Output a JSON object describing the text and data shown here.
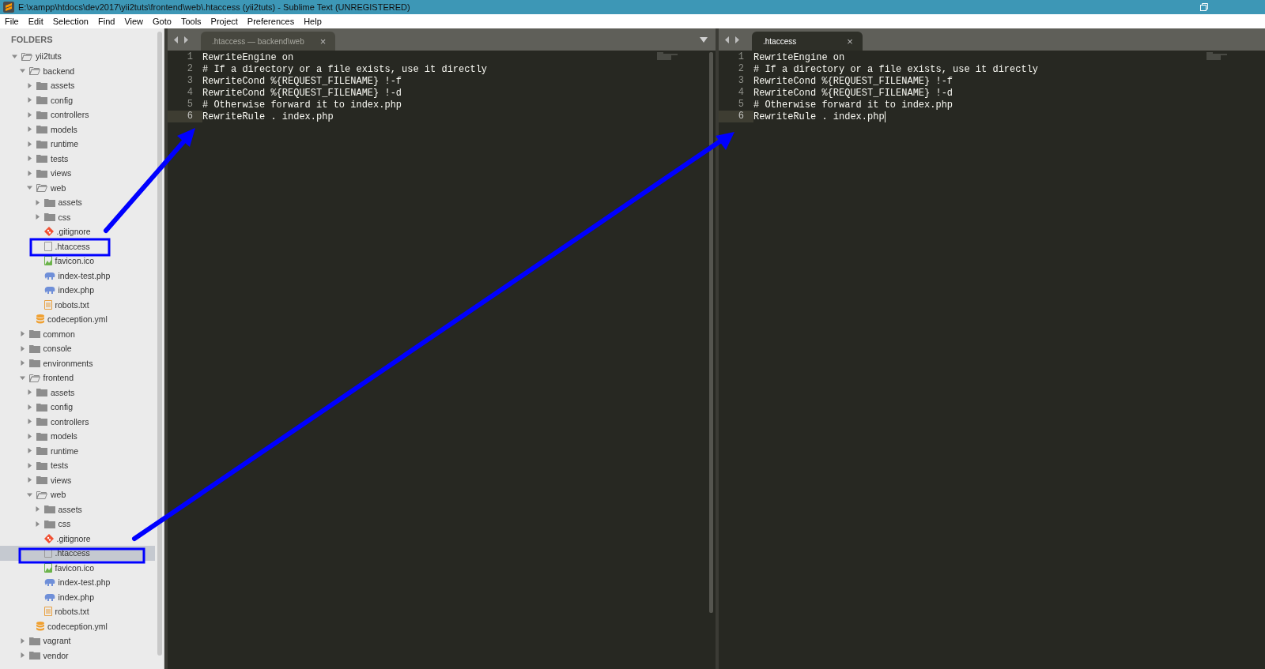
{
  "window": {
    "title": "E:\\xampp\\htdocs\\dev2017\\yii2tuts\\frontend\\web\\.htaccess (yii2tuts) - Sublime Text (UNREGISTERED)"
  },
  "menu": [
    "File",
    "Edit",
    "Selection",
    "Find",
    "View",
    "Goto",
    "Tools",
    "Project",
    "Preferences",
    "Help"
  ],
  "sidebar": {
    "heading": "FOLDERS",
    "tree": [
      {
        "label": "yii2tuts",
        "kind": "folder",
        "expanded": true,
        "selected": false,
        "children": [
          {
            "label": "backend",
            "kind": "folder",
            "expanded": true,
            "selected": false,
            "children": [
              {
                "label": "assets",
                "kind": "folder",
                "expanded": false,
                "selected": false
              },
              {
                "label": "config",
                "kind": "folder",
                "expanded": false,
                "selected": false
              },
              {
                "label": "controllers",
                "kind": "folder",
                "expanded": false,
                "selected": false
              },
              {
                "label": "models",
                "kind": "folder",
                "expanded": false,
                "selected": false
              },
              {
                "label": "runtime",
                "kind": "folder",
                "expanded": false,
                "selected": false
              },
              {
                "label": "tests",
                "kind": "folder",
                "expanded": false,
                "selected": false
              },
              {
                "label": "views",
                "kind": "folder",
                "expanded": false,
                "selected": false
              },
              {
                "label": "web",
                "kind": "folder",
                "expanded": true,
                "selected": false,
                "children": [
                  {
                    "label": "assets",
                    "kind": "folder",
                    "expanded": false,
                    "selected": false
                  },
                  {
                    "label": "css",
                    "kind": "folder",
                    "expanded": false,
                    "selected": false
                  },
                  {
                    "label": ".gitignore",
                    "kind": "git",
                    "selected": false
                  },
                  {
                    "label": ".htaccess",
                    "kind": "file",
                    "selected": false
                  },
                  {
                    "label": "favicon.ico",
                    "kind": "image",
                    "selected": false
                  },
                  {
                    "label": "index-test.php",
                    "kind": "php",
                    "selected": false
                  },
                  {
                    "label": "index.php",
                    "kind": "php",
                    "selected": false
                  },
                  {
                    "label": "robots.txt",
                    "kind": "text",
                    "selected": false
                  }
                ]
              },
              {
                "label": "codeception.yml",
                "kind": "yaml",
                "selected": false
              }
            ]
          },
          {
            "label": "common",
            "kind": "folder",
            "expanded": false,
            "selected": false
          },
          {
            "label": "console",
            "kind": "folder",
            "expanded": false,
            "selected": false
          },
          {
            "label": "environments",
            "kind": "folder",
            "expanded": false,
            "selected": false
          },
          {
            "label": "frontend",
            "kind": "folder",
            "expanded": true,
            "selected": false,
            "children": [
              {
                "label": "assets",
                "kind": "folder",
                "expanded": false,
                "selected": false
              },
              {
                "label": "config",
                "kind": "folder",
                "expanded": false,
                "selected": false
              },
              {
                "label": "controllers",
                "kind": "folder",
                "expanded": false,
                "selected": false
              },
              {
                "label": "models",
                "kind": "folder",
                "expanded": false,
                "selected": false
              },
              {
                "label": "runtime",
                "kind": "folder",
                "expanded": false,
                "selected": false
              },
              {
                "label": "tests",
                "kind": "folder",
                "expanded": false,
                "selected": false
              },
              {
                "label": "views",
                "kind": "folder",
                "expanded": false,
                "selected": false
              },
              {
                "label": "web",
                "kind": "folder",
                "expanded": true,
                "selected": false,
                "children": [
                  {
                    "label": "assets",
                    "kind": "folder",
                    "expanded": false,
                    "selected": false
                  },
                  {
                    "label": "css",
                    "kind": "folder",
                    "expanded": false,
                    "selected": false
                  },
                  {
                    "label": ".gitignore",
                    "kind": "git",
                    "selected": false
                  },
                  {
                    "label": ".htaccess",
                    "kind": "file",
                    "selected": true
                  },
                  {
                    "label": "favicon.ico",
                    "kind": "image",
                    "selected": false
                  },
                  {
                    "label": "index-test.php",
                    "kind": "php",
                    "selected": false
                  },
                  {
                    "label": "index.php",
                    "kind": "php",
                    "selected": false
                  },
                  {
                    "label": "robots.txt",
                    "kind": "text",
                    "selected": false
                  }
                ]
              },
              {
                "label": "codeception.yml",
                "kind": "yaml",
                "selected": false
              }
            ]
          },
          {
            "label": "vagrant",
            "kind": "folder",
            "expanded": false,
            "selected": false
          },
          {
            "label": "vendor",
            "kind": "folder",
            "expanded": false,
            "selected": false
          }
        ]
      }
    ]
  },
  "panes": [
    {
      "tab": {
        "label": ".htaccess — backend\\web",
        "selected": false,
        "close": "×"
      },
      "dropdown": true,
      "lines": [
        {
          "number": "1",
          "text": "RewriteEngine on",
          "current": false,
          "cursor": false
        },
        {
          "number": "2",
          "text": "# If a directory or a file exists, use it directly",
          "current": false,
          "cursor": false
        },
        {
          "number": "3",
          "text": "RewriteCond %{REQUEST_FILENAME} !-f",
          "current": false,
          "cursor": false
        },
        {
          "number": "4",
          "text": "RewriteCond %{REQUEST_FILENAME} !-d",
          "current": false,
          "cursor": false
        },
        {
          "number": "5",
          "text": "# Otherwise forward it to index.php",
          "current": false,
          "cursor": false
        },
        {
          "number": "6",
          "text": "RewriteRule . index.php",
          "current": true,
          "cursor": false
        }
      ]
    },
    {
      "tab": {
        "label": ".htaccess",
        "selected": true,
        "close": "×"
      },
      "dropdown": false,
      "lines": [
        {
          "number": "1",
          "text": "RewriteEngine on",
          "current": false,
          "cursor": false
        },
        {
          "number": "2",
          "text": "# If a directory or a file exists, use it directly",
          "current": false,
          "cursor": false
        },
        {
          "number": "3",
          "text": "RewriteCond %{REQUEST_FILENAME} !-f",
          "current": false,
          "cursor": false
        },
        {
          "number": "4",
          "text": "RewriteCond %{REQUEST_FILENAME} !-d",
          "current": false,
          "cursor": false
        },
        {
          "number": "5",
          "text": "# Otherwise forward it to index.php",
          "current": false,
          "cursor": false
        },
        {
          "number": "6",
          "text": "RewriteRule . index.php",
          "current": true,
          "cursor": true
        }
      ]
    }
  ]
}
